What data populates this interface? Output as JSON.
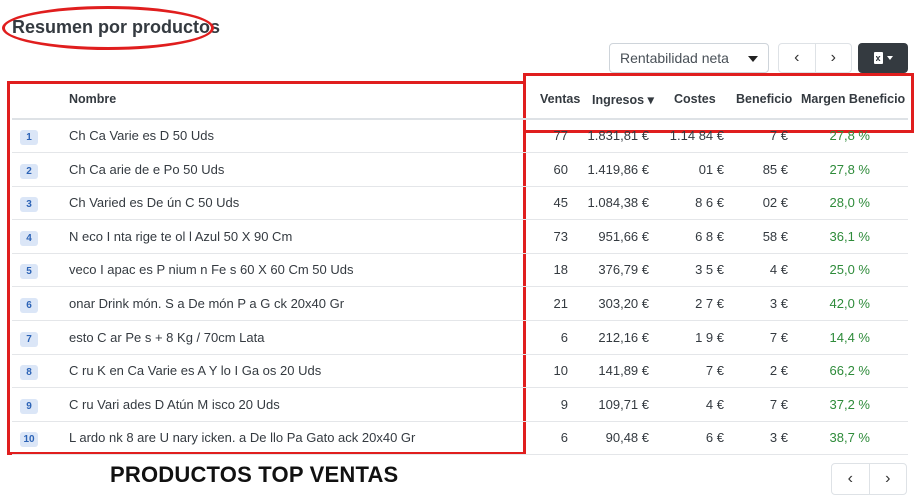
{
  "title": "Resumen por productos",
  "select": {
    "value": "Rentabilidad neta"
  },
  "pager_top": {
    "prev": "‹",
    "next": "›"
  },
  "pager_bottom": {
    "prev": "‹",
    "next": "›"
  },
  "export_icon": "excel-file-icon",
  "annotation_colors": {
    "highlight": "#e01e1e"
  },
  "columns": {
    "name": "Nombre",
    "ventas": "Ventas",
    "ingresos": "Ingresos",
    "costes": "Costes",
    "beneficio": "Beneficio",
    "margen": "Margen Beneficio"
  },
  "sort_indicator": "▾",
  "rows": [
    {
      "idx": "1",
      "name": "Ch  Ca  Varie   es D       50 Uds",
      "ventas": "77",
      "ingresos": "1.831,81 €",
      "costes": "1.14  84 €",
      "beneficio": "   7 €",
      "margen": "27,8 %"
    },
    {
      "idx": "2",
      "name": "Ch  Ca  arie   de    e Po    50 Uds",
      "ventas": "60",
      "ingresos": "1.419,86 €",
      "costes": "   01 €",
      "beneficio": "   85 €",
      "margen": "27,8 %"
    },
    {
      "idx": "3",
      "name": "Ch      Varied   es De    ún C        50 Uds",
      "ventas": "45",
      "ingresos": "1.084,38 €",
      "costes": "8   6 €",
      "beneficio": "   02 €",
      "margen": "28,0 %"
    },
    {
      "idx": "4",
      "name": "N   eco I   nta    rige    te   ol     l Azul 50 X 90 Cm",
      "ventas": "73",
      "ingresos": "951,66 €",
      "costes": "6   8 €",
      "beneficio": "   58 €",
      "margen": "36,1 %"
    },
    {
      "idx": "5",
      "name": "     veco I   apac    es P    nium     n Fe     s 60 X 60 Cm 50 Uds",
      "ventas": "18",
      "ingresos": "376,79 €",
      "costes": "3   5 €",
      "beneficio": "   4 €",
      "margen": "25,0 %"
    },
    {
      "idx": "6",
      "name": "     onar    Drink    món. S   a De    món P   a G        ck 20x40 Gr",
      "ventas": "21",
      "ingresos": "303,20 €",
      "costes": "2   7 €",
      "beneficio": "   3 €",
      "margen": "42,0 %"
    },
    {
      "idx": "7",
      "name": "     esto C    ar Pe    s + 8 Kg / 70cm Lata",
      "ventas": "6",
      "ingresos": "212,16 €",
      "costes": "1   9 €",
      "beneficio": "   7 €",
      "margen": "14,4 %"
    },
    {
      "idx": "8",
      "name": "C    ru  K    en Ca  Varie     es A    Y    lo I    Ga   os 20 Uds",
      "ventas": "10",
      "ingresos": "141,89 €",
      "costes": "   7 €",
      "beneficio": "   2 €",
      "margen": "66,2 %"
    },
    {
      "idx": "9",
      "name": "C    ru    Vari   ades D   Atún    M    isco 20 Uds",
      "ventas": "9",
      "ingresos": "109,71 €",
      "costes": "   4 €",
      "beneficio": "   7 €",
      "margen": "37,2 %"
    },
    {
      "idx": "10",
      "name": "L    ardo    nk 8    are U   nary   icken.    a De    llo Pa   Gato    ack 20x40 Gr",
      "ventas": "6",
      "ingresos": "90,48 €",
      "costes": "   6 €",
      "beneficio": "   3 €",
      "margen": "38,7 %"
    }
  ],
  "footer_label": "PRODUCTOS TOP VENTAS"
}
